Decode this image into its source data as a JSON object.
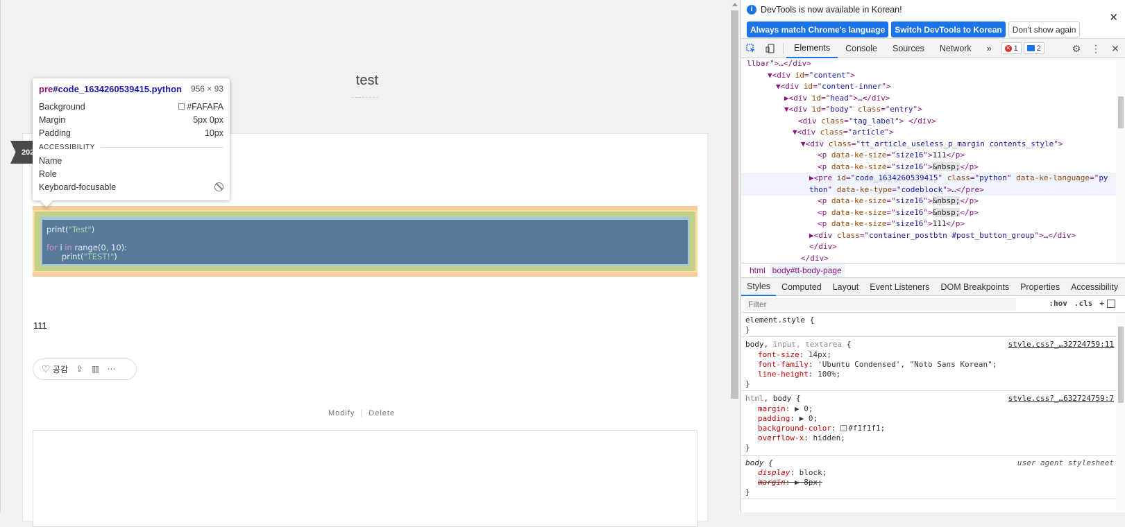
{
  "page": {
    "post_title": "test",
    "date_ribbon": "202",
    "paragraph_111": "111",
    "reaction_label": "공감",
    "modify_label": "Modify",
    "delete_label": "Delete",
    "separator": "|"
  },
  "tooltip": {
    "tag": "pre",
    "id": "#code_1634260539415.python",
    "dimensions": "956 × 93",
    "rows": [
      {
        "label": "Background",
        "value": "#FAFAFA"
      },
      {
        "label": "Margin",
        "value": "5px 0px"
      },
      {
        "label": "Padding",
        "value": "10px"
      }
    ],
    "section": "ACCESSIBILITY",
    "a11y_rows": [
      {
        "label": "Name",
        "value": ""
      },
      {
        "label": "Role",
        "value": ""
      },
      {
        "label": "Keyboard-focusable",
        "value": ""
      }
    ]
  },
  "code": {
    "line1_fn": "print(",
    "line1_str": "\"Test\"",
    "line1_end": ")",
    "line3_kw1": "for",
    "line3_var": " i ",
    "line3_kw2": "in",
    "line3_rest": " range(0, 10):",
    "line4_indent": "      print(",
    "line4_str": "\"TEST!\"",
    "line4_end": ")"
  },
  "devtools": {
    "info_message": "DevTools is now available in Korean!",
    "btn_match": "Always match Chrome's language",
    "btn_switch": "Switch DevTools to Korean",
    "btn_dont_show": "Don't show again",
    "tabs": [
      "Elements",
      "Console",
      "Sources",
      "Network"
    ],
    "more_tabs": "»",
    "error_count": "1",
    "message_count": "2",
    "breadcrumbs": [
      "html",
      "body#tt-body-page"
    ],
    "subtabs": [
      "Styles",
      "Computed",
      "Layout",
      "Event Listeners",
      "DOM Breakpoints",
      "Properties",
      "Accessibility"
    ],
    "filter_placeholder": "Filter",
    "hov": ":hov",
    "cls": ".cls",
    "plus": "+"
  },
  "dom": {
    "l0": "llbar\">…</div>",
    "l1_id": "content",
    "l2_id": "content-inner",
    "l3_id": "head",
    "l4_id": "body",
    "l4_class": "entry",
    "l5_class": "tag_label",
    "l6_class": "article",
    "l7_class": "tt_article_useless_p_margin contents_style",
    "size16": "size16",
    "text111": "111",
    "nbsp": "&nbsp;",
    "pre_id": "code_1634260539415",
    "pre_class": "python",
    "pre_lang_a": "py",
    "pre_lang_b": "thon",
    "pre_type": "codeblock",
    "btn_group_class": "container_postbtn #post_button_group"
  },
  "styles": {
    "element_style": "element.style {",
    "close": "}",
    "r1_sel_a": "body, ",
    "r1_sel_b": "input, textarea",
    "r1_src": "style.css?_…32724759:11",
    "r1_decls": [
      {
        "p": "font-size",
        "v": "14px;"
      },
      {
        "p": "font-family",
        "v": "'Ubuntu Condensed', \"Noto Sans Korean\";"
      },
      {
        "p": "line-height",
        "v": "100%;"
      }
    ],
    "r2_sel_a": "html",
    "r2_sel_b": ", body {",
    "r2_src": "style.css?_…632724759:7",
    "r2_decls": [
      {
        "p": "margin",
        "v": "▶ 0;"
      },
      {
        "p": "padding",
        "v": "▶ 0;"
      },
      {
        "p": "background-color",
        "v": "#f1f1f1;"
      },
      {
        "p": "overflow-x",
        "v": "hidden;"
      }
    ],
    "r3_sel": "body {",
    "r3_src": "user agent stylesheet",
    "r3_decls": [
      {
        "p": "display",
        "v": "block;"
      },
      {
        "p": "margin",
        "v": "▶ 8px;"
      }
    ]
  },
  "colors": {
    "accent": "#1a73e8",
    "margin_highlight": "#f9cc9d",
    "padding_highlight": "#c3d08b",
    "content_highlight": "#a0c6e8",
    "page_bg": "#f1f1f1"
  }
}
